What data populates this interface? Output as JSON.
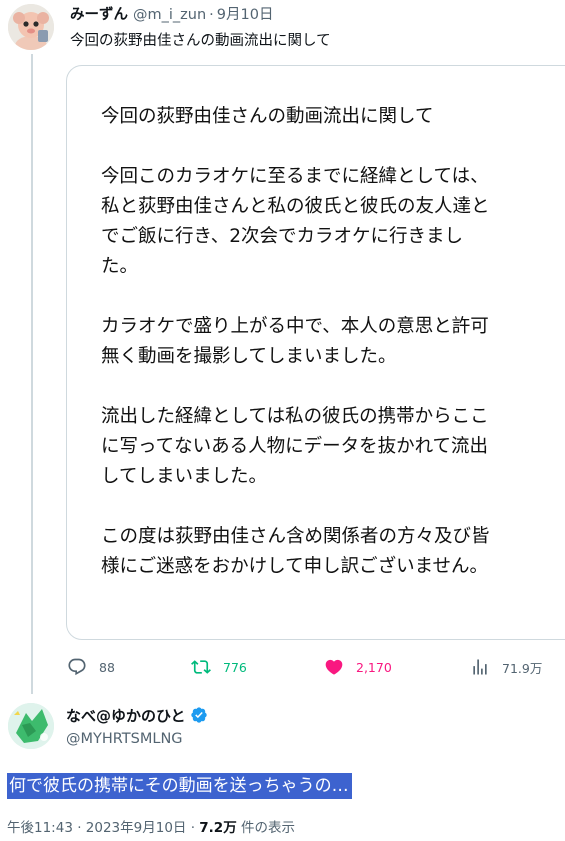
{
  "tweet": {
    "author_name": "みーずん",
    "author_handle": "@m_i_zun",
    "separator": "·",
    "date": "9月10日",
    "text": "今回の荻野由佳さんの動画流出に関して"
  },
  "card": {
    "paragraphs": [
      "今回の荻野由佳さんの動画流出に関して",
      "今回このカラオケに至るまでに経緯としては、\n私と荻野由佳さんと私の彼氏と彼氏の友人達と\nでご飯に行き、2次会でカラオケに行きまし\nた。",
      "カラオケで盛り上がる中で、本人の意思と許可\n無く動画を撮影してしまいました。",
      "流出した経緯としては私の彼氏の携帯からここ\nに写ってないある人物にデータを抜かれて流出\nしてしまいました。",
      "この度は荻野由佳さん含め関係者の方々及び皆\n様にご迷惑をおかけして申し訳ございません。"
    ]
  },
  "actions": {
    "replies": "88",
    "retweets": "776",
    "likes": "2,170",
    "views": "71.9万"
  },
  "reply": {
    "author_name": "なべ@ゆかのひと",
    "author_handle": "@MYHRTSMLNG",
    "text": "何で彼氏の携帯にその動画を送っちゃうの…",
    "time": "午後11:43 · 2023年9月10日 · ",
    "views_count": "7.2万",
    "views_label": " 件の表示"
  },
  "colors": {
    "retweet": "#00ba7c",
    "like": "#f91880",
    "verified": "#1d9bf0",
    "selection": "#3d63cf",
    "muted": "#536471"
  },
  "icons": [
    "reply-icon",
    "retweet-icon",
    "heart-icon",
    "views-icon",
    "verified-icon"
  ]
}
